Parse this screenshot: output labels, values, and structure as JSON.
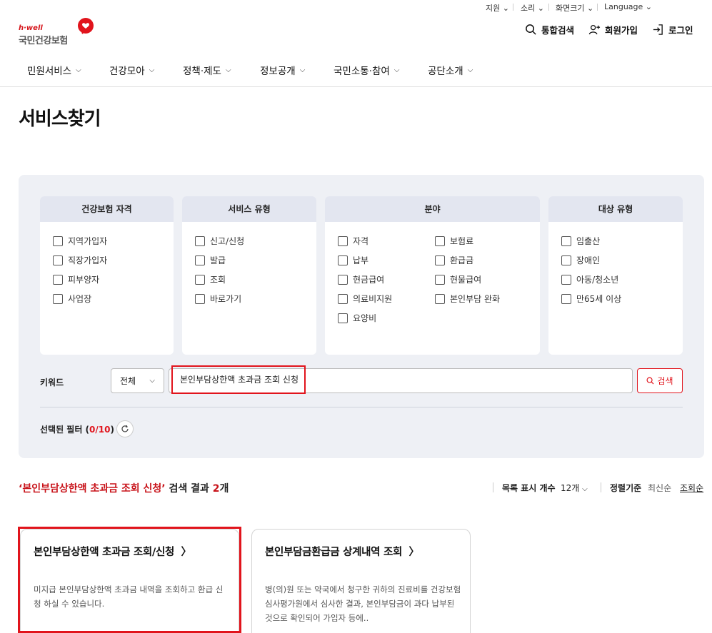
{
  "utility": {
    "support": "지원",
    "sound": "소리",
    "zoom": "화면크기",
    "language": "Language"
  },
  "logo": {
    "tagline": "h·well",
    "name": "국민건강보험"
  },
  "header": {
    "search": "통합검색",
    "signup": "회원가입",
    "login": "로그인"
  },
  "gnb": [
    "민원서비스",
    "건강모아",
    "정책·제도",
    "정보공개",
    "국민소통·참여",
    "공단소개"
  ],
  "page_title": "서비스찾기",
  "filters": {
    "eligibility": {
      "title": "건강보험 자격",
      "items": [
        "지역가입자",
        "직장가입자",
        "피부양자",
        "사업장"
      ]
    },
    "service_type": {
      "title": "서비스 유형",
      "items": [
        "신고/신청",
        "발급",
        "조회",
        "바로가기"
      ]
    },
    "field": {
      "title": "분야",
      "col1": [
        "자격",
        "납부",
        "현금급여",
        "의료비지원",
        "요양비"
      ],
      "col2": [
        "보험료",
        "환급금",
        "현물급여",
        "본인부담 완화"
      ]
    },
    "target": {
      "title": "대상 유형",
      "items": [
        "임출산",
        "장애인",
        "아동/청소년",
        "만65세 이상"
      ]
    }
  },
  "keyword": {
    "label": "키워드",
    "scope": "전체",
    "value": "본인부담상한액 초과금 조회 신청",
    "button": "검색"
  },
  "selected_filter": {
    "label": "선택된 필터 (",
    "count": "0/10",
    "close": ")"
  },
  "results": {
    "query": "본인부담상한액 초과금 조회 신청",
    "suffix": " 검색 결과 ",
    "count": "2",
    "unit": "개",
    "page_size_label": "목록 표시 개수",
    "page_size": "12개",
    "sort_label": "정렬기준",
    "sort_latest": "최신순",
    "sort_views": "조회순",
    "cards": [
      {
        "title": "본인부담상한액 초과금 조회/신청",
        "desc": "미지급 본인부담상한액 초과금 내역을 조회하고 환급 신청 하실 수 있습니다."
      },
      {
        "title": "본인부담금환급금 상계내역 조회",
        "desc": "병(의)원 또는 약국에서 청구한 귀하의 진료비를 건강보험심사평가원에서 심사한 결과, 본인부담금이 과다 납부된 것으로 확인되어 가입자 등에.."
      }
    ]
  },
  "colors": {
    "accent": "#e1141c",
    "panel": "#eef0f5",
    "box_head": "#e3e6f0"
  }
}
